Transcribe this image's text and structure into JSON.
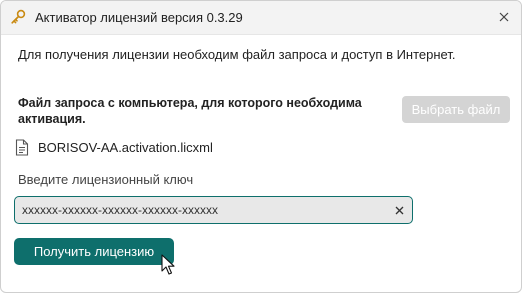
{
  "window": {
    "title": "Активатор лицензий версия 0.3.29",
    "title_icon": "key-icon",
    "close_icon": "close-icon"
  },
  "intro_text": "Для получения лицензии необходим файл запроса и доступ в Интернет.",
  "request_section": {
    "label": "Файл запроса с компьютера, для которого необходима активация.",
    "select_file_label": "Выбрать файл",
    "file_icon": "document-icon",
    "file_name": "BORISOV-AA.activation.licxml"
  },
  "license_key": {
    "label": "Введите лицензионный ключ",
    "value": "xxxxxx-xxxxxx-xxxxxx-xxxxxx-xxxxxx",
    "clear_icon": "clear-icon"
  },
  "actions": {
    "get_license_label": "Получить лицензию"
  },
  "colors": {
    "accent": "#0e6f6c",
    "disabled_button": "#d4d4d4",
    "titlebar": "#f3f3f3",
    "field_background": "#e8e8e8"
  }
}
